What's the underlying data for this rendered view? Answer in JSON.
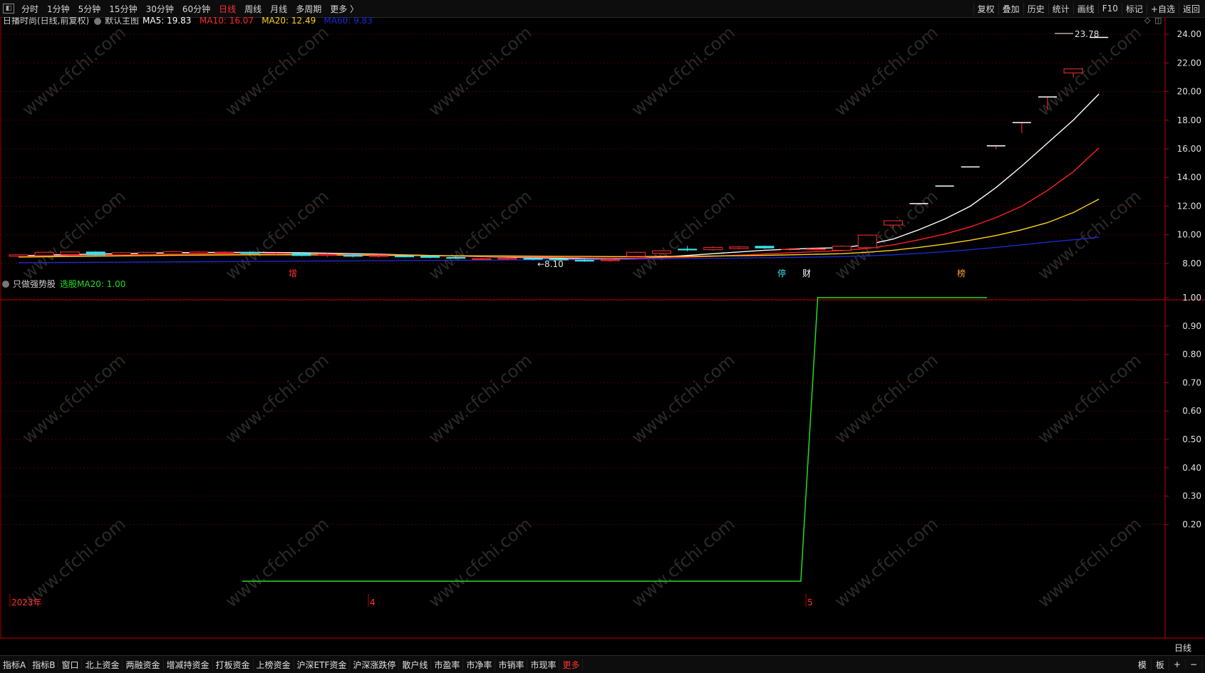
{
  "toolbar": {
    "periods": [
      "分时",
      "1分钟",
      "5分钟",
      "15分钟",
      "30分钟",
      "60分钟",
      "日线",
      "周线",
      "月线",
      "多周期",
      "更多 〉"
    ],
    "active_period": "日线",
    "right_items": [
      "复权",
      "叠加",
      "历史",
      "统计",
      "画线",
      "F10",
      "标记",
      "+自选",
      "返回"
    ]
  },
  "main_panel": {
    "title": "日播时尚(日线,前复权)",
    "indicator_name": "默认主图",
    "legend": [
      {
        "label": "MA5: 19.83",
        "color": "#ffffff"
      },
      {
        "label": "MA10: 16.07",
        "color": "#ff2a2a"
      },
      {
        "label": "MA20: 12.49",
        "color": "#ffd21e"
      },
      {
        "label": "MA60: 9.83",
        "color": "#1a2ad0"
      }
    ],
    "high_label": "23.78",
    "low_label": "←8.10",
    "markers": [
      "增",
      "停",
      "财",
      "榜"
    ]
  },
  "sub_panel": {
    "title": "只做强势股",
    "legend_text": "选股MA20: 1.00",
    "legend_color": "#22dd22"
  },
  "date_axis": {
    "labels": [
      "2023年",
      "4",
      "5"
    ]
  },
  "axis_bottom_label": "日线",
  "watermark": "www.cfchi.com",
  "bottom_tabs": {
    "items": [
      "指标A",
      "指标B",
      "窗口",
      "北上资金",
      "两融资金",
      "增减持资金",
      "打板资金",
      "上榜资金",
      "沪深ETF资金",
      "沪深涨跌停",
      "散户线",
      "市盈率",
      "市净率",
      "市销率",
      "市现率",
      "更多"
    ],
    "active": "更多",
    "right_items": [
      "模",
      "板",
      "+",
      "−"
    ]
  },
  "colors": {
    "up": "#ff3030",
    "down": "#3fe0e8",
    "grid": "#4a0000",
    "axis": "#c00000",
    "ma5": "#ffffff",
    "ma10": "#ff2020",
    "ma20": "#ffd21e",
    "ma60": "#1a2ad0",
    "signal": "#22dd22"
  },
  "chart_data": [
    {
      "type": "candlestick",
      "title": "日播时尚(日线,前复权)",
      "y_ticks": [
        8.0,
        10.0,
        12.0,
        14.0,
        16.0,
        18.0,
        20.0,
        22.0,
        24.0
      ],
      "ylim": [
        7.3,
        24.6
      ],
      "candles": [
        {
          "o": 8.5,
          "h": 8.62,
          "l": 8.45,
          "c": 8.6
        },
        {
          "o": 8.55,
          "h": 8.82,
          "l": 8.5,
          "c": 8.78
        },
        {
          "o": 8.62,
          "h": 8.85,
          "l": 8.58,
          "c": 8.8
        },
        {
          "o": 8.8,
          "h": 8.85,
          "l": 8.55,
          "c": 8.6
        },
        {
          "o": 8.6,
          "h": 8.8,
          "l": 8.55,
          "c": 8.75
        },
        {
          "o": 8.62,
          "h": 8.82,
          "l": 8.58,
          "c": 8.78
        },
        {
          "o": 8.66,
          "h": 8.86,
          "l": 8.62,
          "c": 8.82
        },
        {
          "o": 8.7,
          "h": 8.85,
          "l": 8.66,
          "c": 8.8
        },
        {
          "o": 8.72,
          "h": 8.84,
          "l": 8.68,
          "c": 8.78
        },
        {
          "o": 8.78,
          "h": 8.86,
          "l": 8.62,
          "c": 8.7
        },
        {
          "o": 8.68,
          "h": 8.78,
          "l": 8.6,
          "c": 8.72
        },
        {
          "o": 8.68,
          "h": 8.75,
          "l": 8.5,
          "c": 8.55
        },
        {
          "o": 8.56,
          "h": 8.72,
          "l": 8.45,
          "c": 8.62
        },
        {
          "o": 8.58,
          "h": 8.66,
          "l": 8.42,
          "c": 8.5
        },
        {
          "o": 8.5,
          "h": 8.62,
          "l": 8.4,
          "c": 8.55
        },
        {
          "o": 8.52,
          "h": 8.6,
          "l": 8.42,
          "c": 8.48
        },
        {
          "o": 8.5,
          "h": 8.58,
          "l": 8.36,
          "c": 8.42
        },
        {
          "o": 8.42,
          "h": 8.5,
          "l": 8.3,
          "c": 8.36
        },
        {
          "o": 8.3,
          "h": 8.4,
          "l": 8.24,
          "c": 8.34
        },
        {
          "o": 8.3,
          "h": 8.4,
          "l": 8.22,
          "c": 8.36
        },
        {
          "o": 8.35,
          "h": 8.42,
          "l": 8.22,
          "c": 8.3
        },
        {
          "o": 8.3,
          "h": 8.38,
          "l": 8.2,
          "c": 8.24
        },
        {
          "o": 8.22,
          "h": 8.32,
          "l": 8.1,
          "c": 8.18
        },
        {
          "o": 8.2,
          "h": 8.3,
          "l": 8.12,
          "c": 8.25
        },
        {
          "o": 8.5,
          "h": 8.82,
          "l": 8.46,
          "c": 8.78
        },
        {
          "o": 8.7,
          "h": 8.92,
          "l": 8.62,
          "c": 8.88
        },
        {
          "o": 9.0,
          "h": 9.22,
          "l": 8.85,
          "c": 8.95
        },
        {
          "o": 8.96,
          "h": 9.2,
          "l": 8.9,
          "c": 9.12
        },
        {
          "o": 9.04,
          "h": 9.22,
          "l": 8.98,
          "c": 9.15
        },
        {
          "o": 9.2,
          "h": 9.25,
          "l": 9.02,
          "c": 9.08
        },
        {
          "o": 8.98,
          "h": 9.08,
          "l": 8.88,
          "c": 8.98
        },
        {
          "o": 8.98,
          "h": 9.1,
          "l": 8.9,
          "c": 9.02
        },
        {
          "o": 8.92,
          "h": 9.26,
          "l": 8.86,
          "c": 9.2
        },
        {
          "o": 9.1,
          "h": 9.98,
          "l": 9.1,
          "c": 9.98
        },
        {
          "o": 10.68,
          "h": 11.0,
          "l": 10.45,
          "c": 10.98
        },
        {
          "o": 12.18,
          "h": 12.18,
          "l": 12.18,
          "c": 12.18
        },
        {
          "o": 13.4,
          "h": 13.4,
          "l": 13.4,
          "c": 13.4
        },
        {
          "o": 14.74,
          "h": 14.74,
          "l": 14.74,
          "c": 14.74
        },
        {
          "o": 16.21,
          "h": 16.21,
          "l": 15.98,
          "c": 16.21
        },
        {
          "o": 17.83,
          "h": 17.83,
          "l": 17.1,
          "c": 17.83
        },
        {
          "o": 19.62,
          "h": 19.62,
          "l": 18.7,
          "c": 19.62
        },
        {
          "o": 21.3,
          "h": 21.58,
          "l": 20.98,
          "c": 21.58
        },
        {
          "o": 23.78,
          "h": 23.78,
          "l": 23.78,
          "c": 23.78
        }
      ],
      "series": [
        {
          "name": "MA5",
          "values": [
            8.55,
            8.58,
            8.62,
            8.65,
            8.68,
            8.72,
            8.74,
            8.76,
            8.77,
            8.77,
            8.76,
            8.74,
            8.71,
            8.68,
            8.64,
            8.6,
            8.56,
            8.52,
            8.48,
            8.44,
            8.4,
            8.36,
            8.32,
            8.3,
            8.36,
            8.44,
            8.56,
            8.68,
            8.8,
            8.92,
            9.0,
            9.06,
            9.1,
            9.32,
            9.7,
            10.35,
            11.1,
            12.0,
            13.3,
            14.8,
            16.4,
            18.0,
            19.83
          ]
        },
        {
          "name": "MA10",
          "values": [
            8.5,
            8.52,
            8.55,
            8.58,
            8.6,
            8.62,
            8.64,
            8.65,
            8.66,
            8.66,
            8.66,
            8.65,
            8.64,
            8.62,
            8.6,
            8.58,
            8.55,
            8.52,
            8.5,
            8.47,
            8.45,
            8.43,
            8.4,
            8.38,
            8.38,
            8.4,
            8.44,
            8.5,
            8.58,
            8.66,
            8.74,
            8.82,
            8.9,
            9.05,
            9.3,
            9.65,
            10.05,
            10.55,
            11.2,
            12.0,
            13.1,
            14.4,
            16.07
          ]
        },
        {
          "name": "MA20",
          "values": [
            8.45,
            8.47,
            8.49,
            8.51,
            8.53,
            8.55,
            8.57,
            8.58,
            8.59,
            8.6,
            8.6,
            8.6,
            8.59,
            8.58,
            8.57,
            8.56,
            8.55,
            8.54,
            8.53,
            8.52,
            8.51,
            8.5,
            8.49,
            8.48,
            8.48,
            8.49,
            8.5,
            8.52,
            8.54,
            8.57,
            8.6,
            8.64,
            8.68,
            8.78,
            8.92,
            9.12,
            9.35,
            9.62,
            9.95,
            10.35,
            10.85,
            11.55,
            12.49
          ]
        },
        {
          "name": "MA60",
          "values": [
            8.05,
            8.06,
            8.07,
            8.08,
            8.09,
            8.1,
            8.11,
            8.12,
            8.13,
            8.14,
            8.15,
            8.16,
            8.17,
            8.18,
            8.19,
            8.2,
            8.21,
            8.22,
            8.23,
            8.24,
            8.25,
            8.26,
            8.27,
            8.28,
            8.3,
            8.32,
            8.34,
            8.36,
            8.38,
            8.4,
            8.42,
            8.45,
            8.48,
            8.53,
            8.6,
            8.7,
            8.82,
            8.96,
            9.12,
            9.3,
            9.48,
            9.65,
            9.83
          ]
        }
      ]
    },
    {
      "type": "line",
      "title": "只做强势股",
      "y_ticks": [
        0.2,
        0.3,
        0.4,
        0.5,
        0.6,
        0.7,
        0.8,
        0.9,
        1.0
      ],
      "ylim": [
        -0.04,
        1.03
      ],
      "series": [
        {
          "name": "选股MA20",
          "values": [
            0,
            0,
            0,
            0,
            0,
            0,
            0,
            0,
            0,
            0,
            0,
            0,
            0,
            0,
            0,
            0,
            0,
            0,
            0,
            0,
            0,
            0,
            0,
            0,
            0,
            0,
            0,
            0,
            0,
            0,
            0,
            0,
            0,
            0,
            1,
            1,
            1,
            1,
            1,
            1,
            1,
            1,
            1,
            1,
            1
          ]
        }
      ]
    }
  ]
}
